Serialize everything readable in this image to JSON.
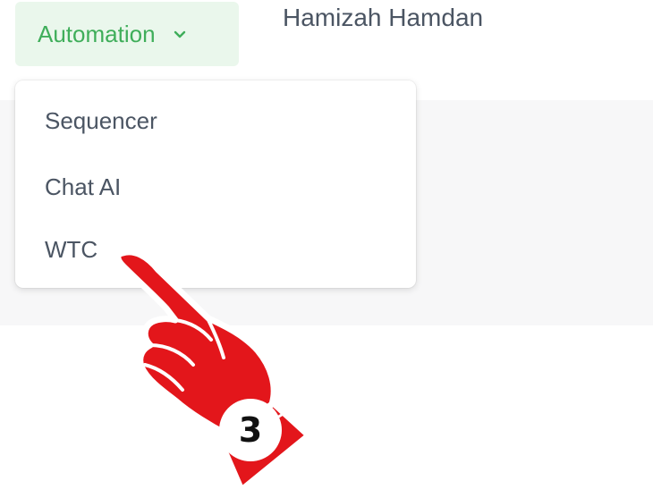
{
  "header": {
    "automation_label": "Automation",
    "user_name": "Hamizah Hamdan"
  },
  "dropdown": {
    "items": [
      {
        "label": "Sequencer"
      },
      {
        "label": "Chat AI"
      },
      {
        "label": "WTC"
      }
    ]
  },
  "annotation": {
    "step_number": "3"
  },
  "colors": {
    "accent_green": "#3fae5a",
    "button_bg": "#eaf7ec",
    "text_gray": "#4b5563",
    "hand_red": "#e3161b"
  },
  "icons": {
    "chevron": "chevron-down-icon",
    "hand": "pointing-hand-icon"
  }
}
